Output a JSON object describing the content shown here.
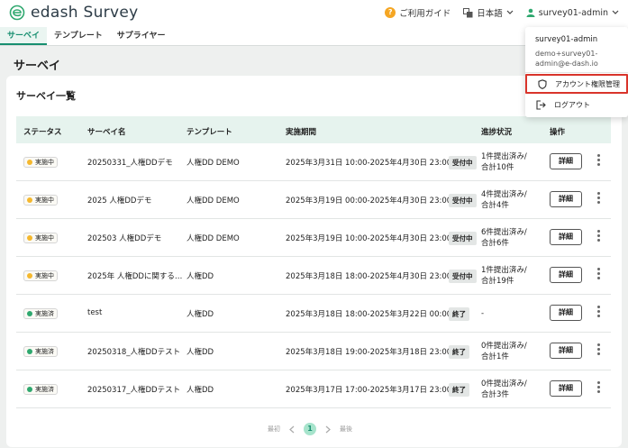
{
  "header": {
    "brand": "edash Survey",
    "help_badge": "?",
    "help_label": "ご利用ガイド",
    "language": "日本語",
    "user": "survey01-admin"
  },
  "tabs": [
    {
      "label": "サーベイ",
      "active": true
    },
    {
      "label": "テンプレート",
      "active": false
    },
    {
      "label": "サプライヤー",
      "active": false
    }
  ],
  "page_title": "サーベイ",
  "card_title": "サーベイ一覧",
  "table": {
    "headers": [
      "ステータス",
      "サーベイ名",
      "テンプレート",
      "実施期間",
      "進捗状況",
      "操作"
    ],
    "detail_label": "詳細",
    "rows": [
      {
        "status": "実施中",
        "status_color": "#f5b82e",
        "name": "20250331_人権DDデモ",
        "template": "人権DD DEMO",
        "period": "2025年3月31日 10:00-2025年4月30日 23:00",
        "badge": "受付中",
        "progress1": "1件提出済み/",
        "progress2": "合計10件"
      },
      {
        "status": "実施中",
        "status_color": "#f5b82e",
        "name": "2025 人権DDデモ",
        "template": "人権DD DEMO",
        "period": "2025年3月19日 00:00-2025年4月30日 23:00",
        "badge": "受付中",
        "progress1": "4件提出済み/",
        "progress2": "合計4件"
      },
      {
        "status": "実施中",
        "status_color": "#f5b82e",
        "name": "202503 人権DDデモ",
        "template": "人権DD DEMO",
        "period": "2025年3月19日 10:00-2025年4月30日 23:00",
        "badge": "受付中",
        "progress1": "6件提出済み/",
        "progress2": "合計6件"
      },
      {
        "status": "実施中",
        "status_color": "#f5b82e",
        "name": "2025年 人権DDに関する…",
        "template": "人権DD",
        "period": "2025年3月18日 18:00-2025年4月30日 23:00",
        "badge": "受付中",
        "progress1": "1件提出済み/",
        "progress2": "合計19件"
      },
      {
        "status": "実施済",
        "status_color": "#2fa86f",
        "name": "test",
        "template": "人権DD",
        "period": "2025年3月18日 18:00-2025年3月22日 00:00",
        "badge": "終了",
        "progress1": "-",
        "progress2": ""
      },
      {
        "status": "実施済",
        "status_color": "#2fa86f",
        "name": "20250318_人権DDテスト",
        "template": "人権DD",
        "period": "2025年3月18日 19:00-2025年3月18日 23:00",
        "badge": "終了",
        "progress1": "0件提出済み/",
        "progress2": "合計1件"
      },
      {
        "status": "実施済",
        "status_color": "#2fa86f",
        "name": "20250317_人権DDテスト",
        "template": "人権DD",
        "period": "2025年3月17日 17:00-2025年3月17日 23:00",
        "badge": "終了",
        "progress1": "0件提出済み/",
        "progress2": "合計3件"
      }
    ]
  },
  "pagination": {
    "first": "最初",
    "current": "1",
    "last": "最後"
  },
  "dropdown": {
    "user": "survey01-admin",
    "email_line1": "demo+survey01-",
    "email_line2": "admin@e-dash.io",
    "items": [
      "アカウント権限管理",
      "ログアウト"
    ]
  },
  "colors": {
    "accent": "#178f70",
    "highlight_border": "#d9342b"
  }
}
